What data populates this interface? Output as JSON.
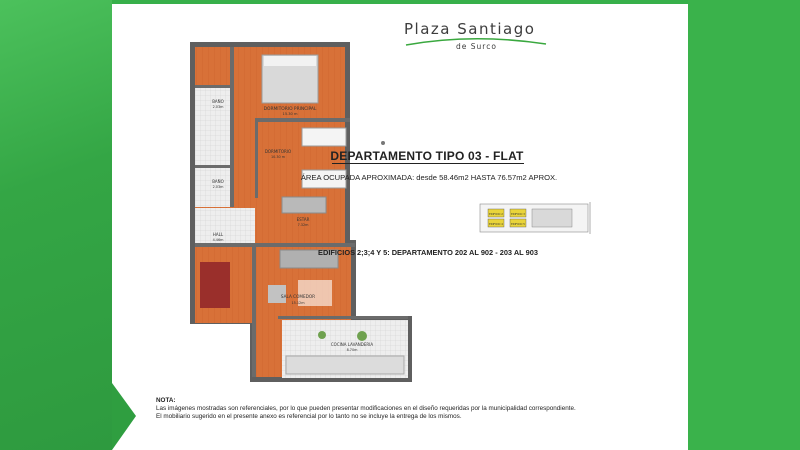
{
  "logo": {
    "name": "Plaza Santiago",
    "sub": "de Surco",
    "swoosh_color": "#3aa83f"
  },
  "heading": {
    "title": "DEPARTAMENTO TIPO 03 - FLAT",
    "area": "ÁREA OCUPADA APROXIMADA: desde 58.46m2 HASTA 76.57m2 APROX.",
    "buildings": "EDIFICIOS 2;3;4 Y 5: DEPARTAMENTO 202 AL 902 - 203 AL 903"
  },
  "plan": {
    "rooms": {
      "master": "DORMITORIO PRINCIPAL",
      "master_area": "15.30 m",
      "bath1": "BAÑO",
      "bath1_area": "2.03m",
      "bedroom": "DORMITORIO",
      "bedroom_area": "10.30 m",
      "bath2": "BAÑO",
      "bath2_area": "2.03m",
      "study": "ESTAR",
      "study_area": "7.32m",
      "hall": "HALL",
      "hall_area": "4.46m",
      "living": "SALA COMEDOR",
      "living_area": "15.12m",
      "kitchen": "COCINA LAVANDERIA",
      "kitchen_area": "8.70m"
    }
  },
  "keyplan": {
    "labels": [
      "EDIFICIO 2",
      "EDIFICIO 3",
      "EDIFICIO 4",
      "EDIFICIO 5"
    ],
    "highlight": "#e9d43a"
  },
  "note": {
    "title": "NOTA:",
    "line1": "Las imágenes mostradas son referenciales, por lo que pueden presentar modificaciones en el diseño requeridas por la municipalidad correspondiente.",
    "line2": "El mobiliario sugerido en el presente anexo es referencial por lo tanto no se incluye la entrega de los mismos."
  },
  "colors": {
    "frame_green": "#37b04a",
    "floor_wood": "#d8743c",
    "wall": "#6b6b6b"
  }
}
